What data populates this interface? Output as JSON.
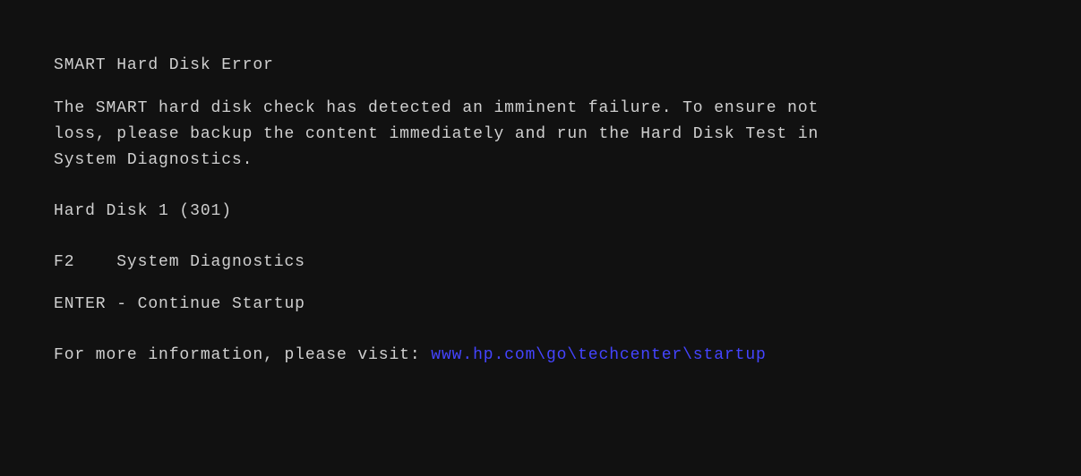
{
  "screen": {
    "background_color": "#111111",
    "text_color": "#d0d0d0",
    "link_color": "#4444ff"
  },
  "title": "SMART Hard Disk Error",
  "description_line1": "The SMART hard disk check has detected an imminent failure.  To ensure not",
  "description_line2": " loss, please backup the content immediately and run the Hard Disk Test in",
  "description_line3": "System Diagnostics.",
  "disk_id": "Hard Disk 1 (301)",
  "action_f2_key": "F2",
  "action_f2_label": "System Diagnostics",
  "action_enter_key": "ENTER",
  "action_enter_separator": "-",
  "action_enter_label": "Continue Startup",
  "info_prefix": "For more information, please visit:",
  "info_link": "www.hp.com\\go\\techcenter\\startup"
}
